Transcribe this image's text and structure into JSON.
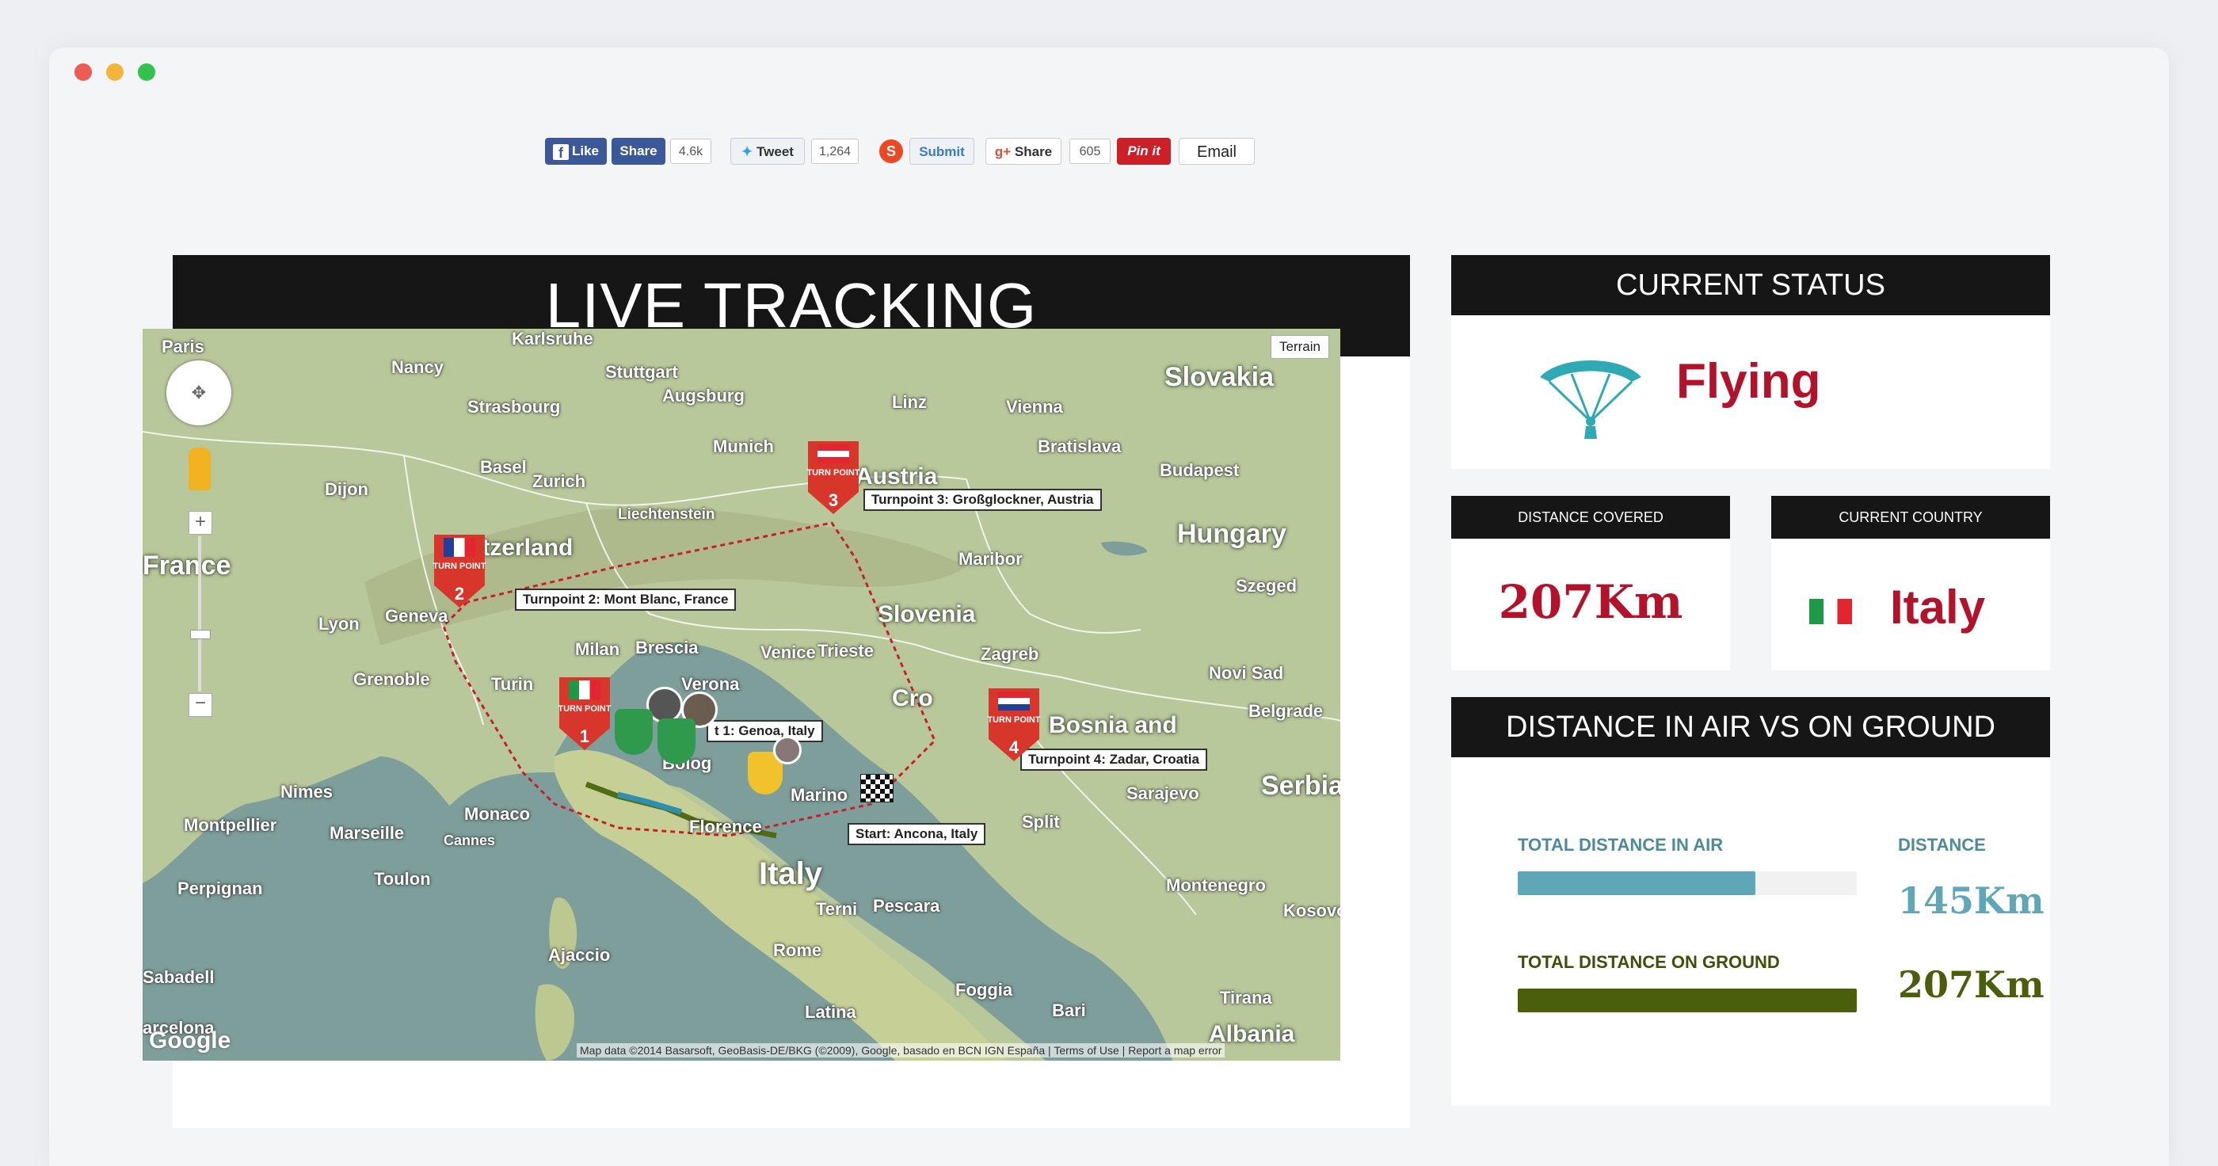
{
  "social": {
    "fb_like": "Like",
    "fb_share": "Share",
    "fb_count": "4.6k",
    "tweet": "Tweet",
    "tweet_count": "1,264",
    "submit": "Submit",
    "gplus_share": "Share",
    "gplus_count": "605",
    "pinit": "Pin it",
    "email": "Email"
  },
  "live": {
    "title": "LIVE TRACKING"
  },
  "map": {
    "terrain": "Terrain",
    "google": "Google",
    "attribution": "Map data ©2014 Basarsoft, GeoBasis-DE/BKG (©2009), Google, basado en BCN IGN España  |  Terms of Use  |  Report a map error",
    "labels": {
      "slovakia": "Slovakia",
      "austria": "Austria",
      "hungary": "Hungary",
      "france": "France",
      "switzerland": "itzerland",
      "slovenia": "Slovenia",
      "italy": "Italy",
      "bosnia": "Bosnia and",
      "serbia": "Serbia",
      "albania": "Albania",
      "croatia": "Cro",
      "paris": "Paris",
      "karlsruhe": "Karlsruhe",
      "stuttgart": "Stuttgart",
      "augsburg": "Augsburg",
      "munich": "Munich",
      "vienna": "Vienna",
      "bratislava": "Bratislava",
      "budapest": "Budapest",
      "zurich": "Zurich",
      "geneva": "Geneva",
      "lyon": "Lyon",
      "milan": "Milan",
      "turin": "Turin",
      "venice": "Venice",
      "trieste": "Trieste",
      "zagreb": "Zagreb",
      "florence": "Florence",
      "rome": "Rome",
      "marseille": "Marseille",
      "monaco": "Monaco",
      "toulon": "Toulon",
      "nimes": "Nimes",
      "montpellier": "Montpellier",
      "perpignan": "Perpignan",
      "sarajevo": "Sarajevo",
      "split": "Split",
      "belgrade": "Belgrade",
      "bari": "Bari",
      "foggia": "Foggia",
      "pescara": "Pescara",
      "barcelona": "arcelona",
      "sabadell": "Sabadell",
      "dijon": "Dijon",
      "nancy": "Nancy",
      "grenoble": "Grenoble",
      "liechtenstein": "Liechtenstein",
      "basel": "Basel",
      "strasbourg": "Strasbourg",
      "linz": "Linz",
      "maribor": "Maribor",
      "szeged": "Szeged",
      "novisad": "Novi Sad",
      "montenegro": "Montenegro",
      "tirana": "Tirana",
      "kosovo": "Kosovo",
      "ajaccio": "Ajaccio",
      "cannes": "Cannes",
      "bologna": "Bolog",
      "sanmarino": "Marino",
      "verona": "Verona",
      "brescia": "Brescia",
      "latina": "Latina",
      "terni": "Terni"
    },
    "callouts": {
      "tp1": "t 1: Genoa, Italy",
      "tp2": "Turnpoint 2: Mont Blanc, France",
      "tp3": "Turnpoint 3: Großglockner, Austria",
      "tp4": "Turnpoint 4: Zadar, Croatia",
      "start": "Start: Ancona, Italy"
    },
    "pins": {
      "tp_text": "TURN POINT",
      "n1": "1",
      "n2": "2",
      "n3": "3",
      "n4": "4"
    }
  },
  "status": {
    "header": "CURRENT STATUS",
    "value": "Flying"
  },
  "distance_covered": {
    "header": "DISTANCE COVERED",
    "value": "207Km"
  },
  "current_country": {
    "header": "CURRENT COUNTRY",
    "value": "Italy"
  },
  "air_ground": {
    "header": "DISTANCE IN AIR VS ON GROUND",
    "air_label": "TOTAL DISTANCE IN AIR",
    "ground_label": "TOTAL DISTANCE ON GROUND",
    "distance_label": "DISTANCE",
    "air_value": "145Km",
    "ground_value": "207Km",
    "air_fraction": 0.7,
    "ground_fraction": 1.0,
    "air_color": "#5fa6b6",
    "ground_color": "#4a5e0c"
  },
  "colors": {
    "accent_red": "#b3132a",
    "teal": "#2fa9b4"
  }
}
